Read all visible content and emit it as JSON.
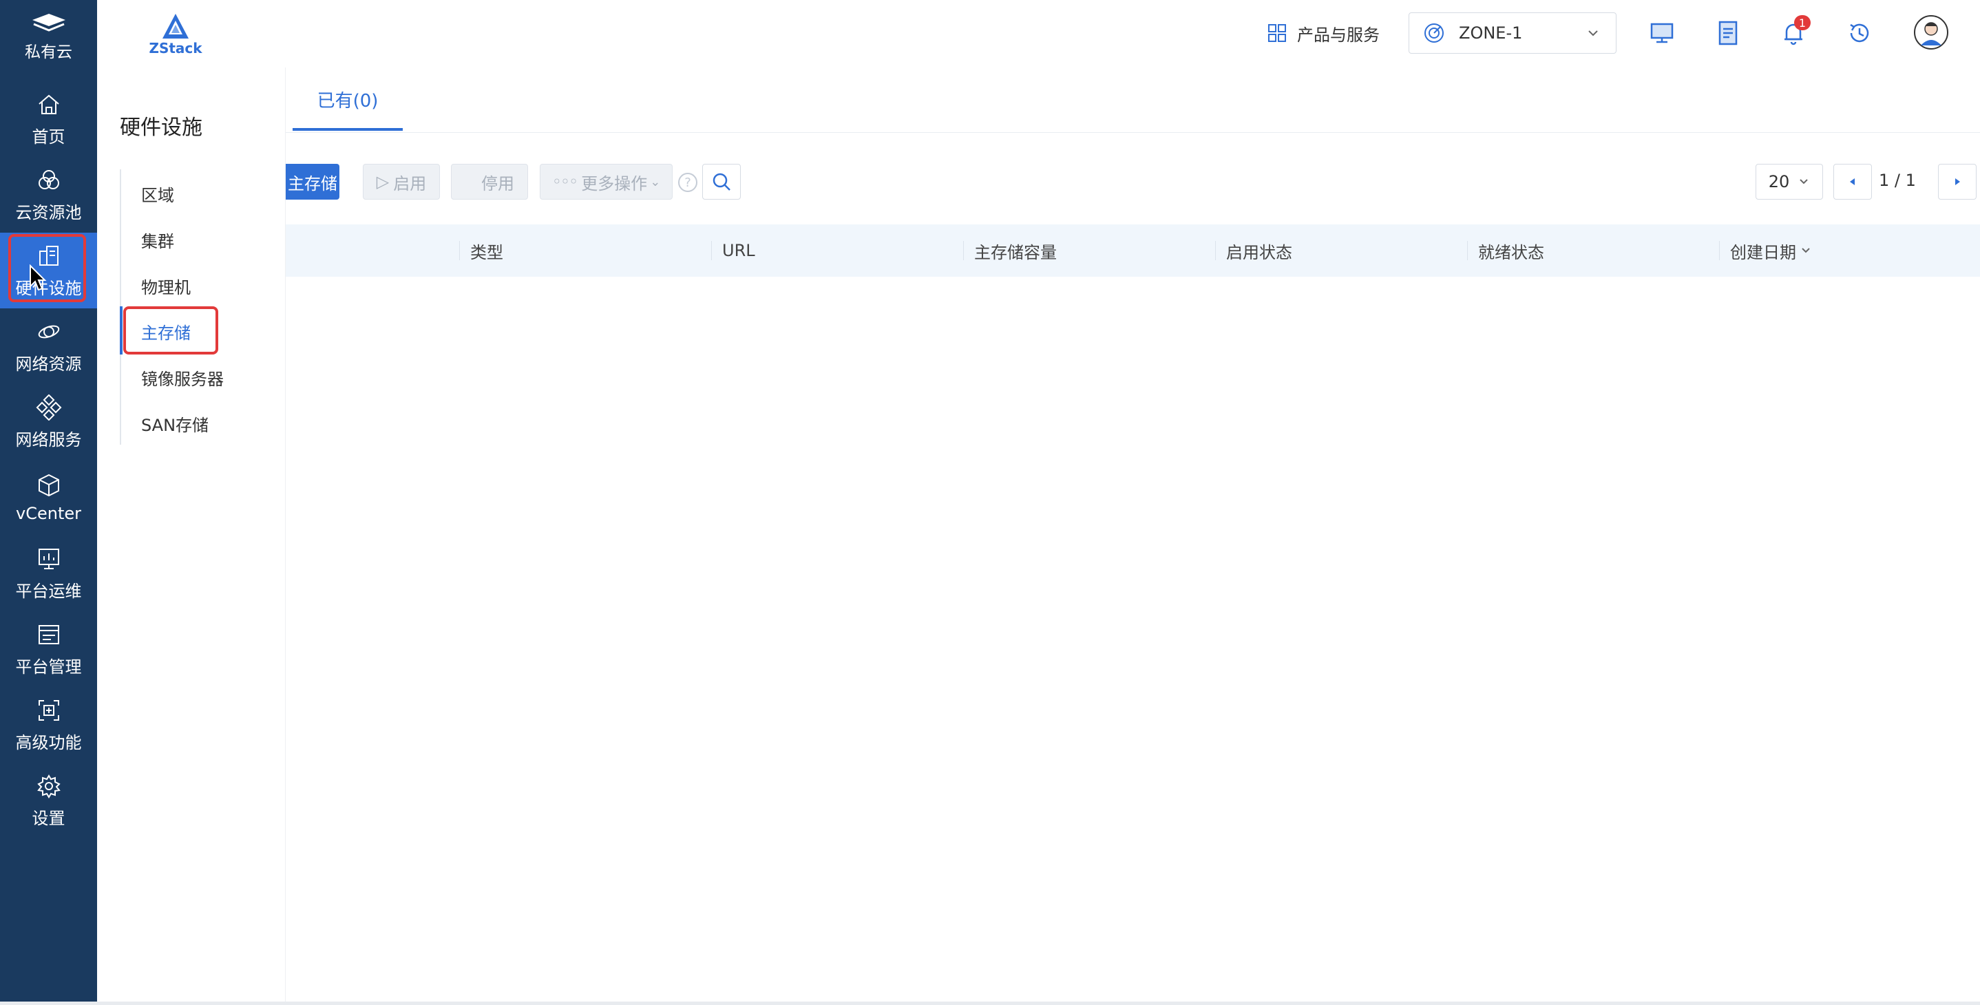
{
  "rail": {
    "brand": "私有云",
    "items": [
      {
        "label": "首页",
        "icon": "home-icon"
      },
      {
        "label": "云资源池",
        "icon": "cloud-pool-icon"
      },
      {
        "label": "硬件设施",
        "icon": "hardware-icon"
      },
      {
        "label": "网络资源",
        "icon": "network-resource-icon"
      },
      {
        "label": "网络服务",
        "icon": "network-service-icon"
      },
      {
        "label": "vCenter",
        "icon": "cube-icon"
      },
      {
        "label": "平台运维",
        "icon": "monitor-chart-icon"
      },
      {
        "label": "平台管理",
        "icon": "platform-manage-icon"
      },
      {
        "label": "高级功能",
        "icon": "advanced-icon"
      },
      {
        "label": "设置",
        "icon": "gear-icon"
      }
    ]
  },
  "header": {
    "logo_text": "ZStack",
    "products_label": "产品与服务",
    "zone": "ZONE-1",
    "notification_count": "1"
  },
  "submenu": {
    "title": "硬件设施",
    "items": [
      "区域",
      "集群",
      "物理机",
      "主存储",
      "镜像服务器",
      "SAN存储"
    ],
    "active": "主存储"
  },
  "main": {
    "tab_label": "已有(0)",
    "toolbar": {
      "create_label": "主存储",
      "enable_label": "启用",
      "disable_label": "停用",
      "more_label": "更多操作",
      "help_label": "?"
    },
    "pagination": {
      "page_size": "20",
      "page_text": "1 / 1"
    },
    "columns": [
      "类型",
      "URL",
      "主存储容量",
      "启用状态",
      "就绪状态",
      "创建日期"
    ]
  },
  "colors": {
    "rail_bg": "#1a3a5f",
    "accent": "#2f6fd6",
    "highlight": "#e23a3a"
  }
}
